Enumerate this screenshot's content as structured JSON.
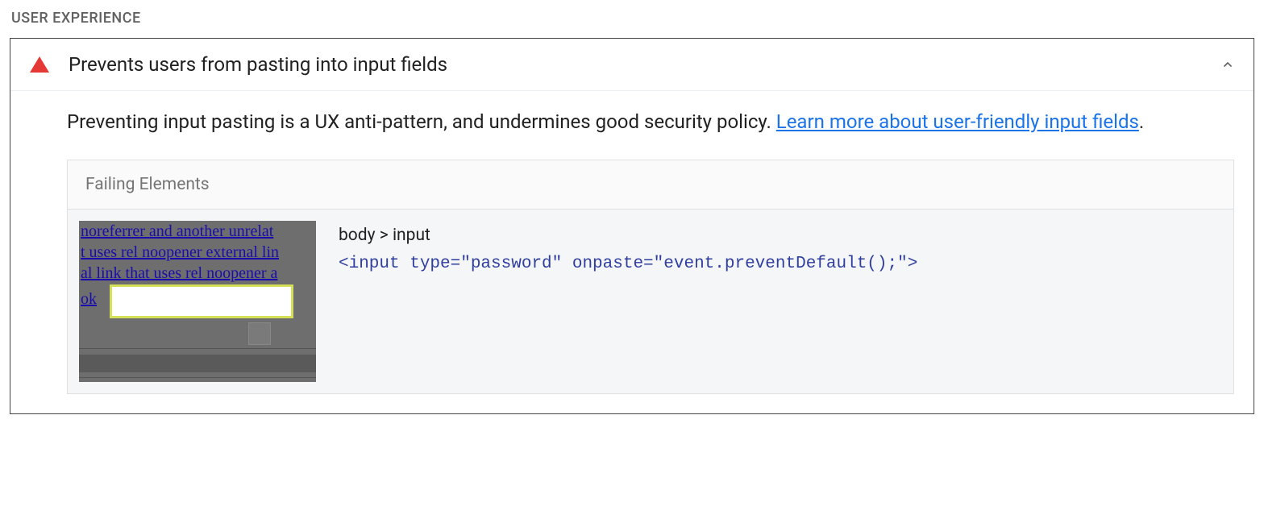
{
  "section": {
    "heading": "USER EXPERIENCE"
  },
  "audit": {
    "title": "Prevents users from pasting into input fields",
    "description_text": "Preventing input pasting is a UX anti-pattern, and undermines good security policy. ",
    "learn_more_label": "Learn more about user-friendly input fields",
    "period": "."
  },
  "table": {
    "header": "Failing Elements",
    "row": {
      "selector": "body > input",
      "code": "<input type=\"password\" onpaste=\"event.preventDefault();\">"
    }
  },
  "thumb": {
    "line1": " noreferrer and another unrelat",
    "line2": "t uses rel noopener external lin",
    "line3": "al link that uses rel noopener a",
    "ok_label": " ok"
  }
}
